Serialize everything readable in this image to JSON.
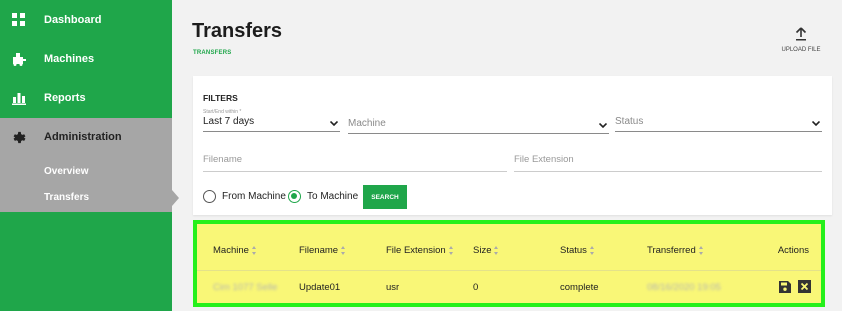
{
  "sidebar": {
    "items": [
      {
        "label": "Dashboard",
        "icon": "grid-icon"
      },
      {
        "label": "Machines",
        "icon": "machine-icon"
      },
      {
        "label": "Reports",
        "icon": "bar-chart-icon"
      },
      {
        "label": "Administration",
        "icon": "gear-icon"
      }
    ],
    "sub_items": [
      {
        "label": "Overview"
      },
      {
        "label": "Transfers"
      }
    ]
  },
  "header": {
    "title": "Transfers",
    "breadcrumb": "TRANSFERS",
    "upload_label": "UPLOAD FILE"
  },
  "filters": {
    "title": "FILTERS",
    "period_label": "Start/End within *",
    "period_value": "Last 7 days",
    "machine_placeholder": "Machine",
    "status_placeholder": "Status",
    "filename_placeholder": "Filename",
    "extension_placeholder": "File Extension",
    "radio_from": "From Machine",
    "radio_to": "To Machine",
    "radio_selected": "To Machine",
    "search_label": "SEARCH"
  },
  "table": {
    "columns": [
      "Machine",
      "Filename",
      "File Extension",
      "Size",
      "Status",
      "Transferred",
      "Actions"
    ],
    "rows": [
      {
        "machine": "Cim 1077 Selle",
        "filename": "Update01",
        "extension": "usr",
        "size": "0",
        "status": "complete",
        "transferred": "08/16/2020 19:05"
      }
    ]
  },
  "colors": {
    "brand_green": "#1fa64a",
    "sidebar_active_bg": "#a6a6a6",
    "highlight_yellow": "#f9f777",
    "highlight_border": "#25f01b"
  }
}
